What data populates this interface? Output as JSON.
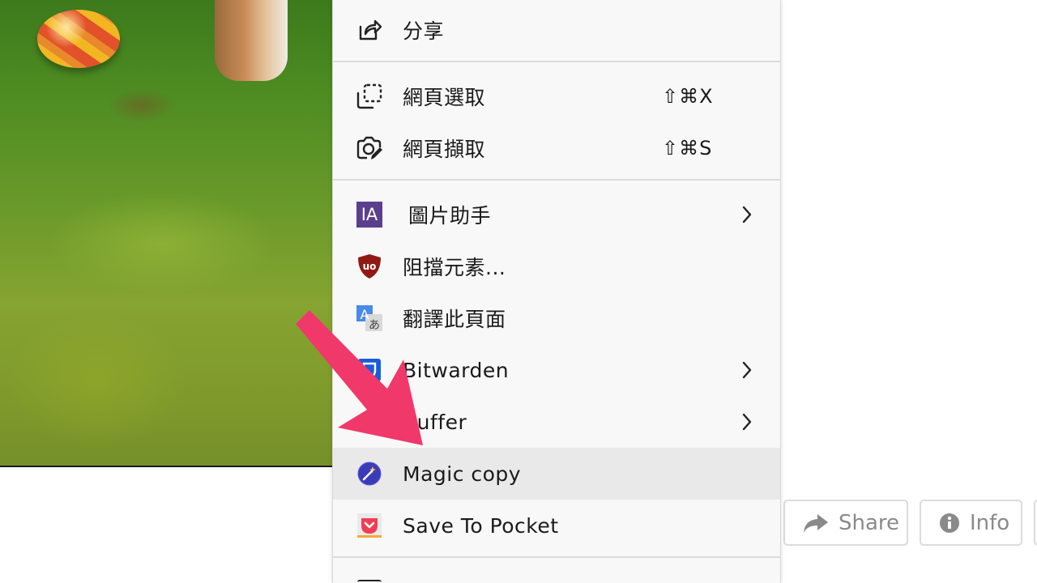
{
  "menu": {
    "items": [
      {
        "label": "分享",
        "icon": "share-icon"
      },
      {
        "label": "網頁選取",
        "shortcut": "⇧⌘X",
        "icon": "selection-icon"
      },
      {
        "label": "網頁擷取",
        "shortcut": "⇧⌘S",
        "icon": "screenshot-icon"
      },
      {
        "label": "圖片助手",
        "icon": "imageassistant-icon",
        "icon_text": "IA",
        "submenu": true
      },
      {
        "label": "阻擋元素...",
        "icon": "ublock-icon",
        "icon_text": "uo"
      },
      {
        "label": "翻譯此頁面",
        "icon": "translate-icon",
        "icon_text": "A"
      },
      {
        "label": "Bitwarden",
        "icon": "bitwarden-icon",
        "submenu": true
      },
      {
        "label": "Buffer",
        "icon": "buffer-icon",
        "submenu": true
      },
      {
        "label": "Magic copy",
        "icon": "magic-copy-icon",
        "highlighted": true
      },
      {
        "label": "Save To Pocket",
        "icon": "pocket-icon"
      }
    ],
    "colors": {
      "highlight": "#e9e9e9",
      "background": "#f8f8f8"
    }
  },
  "buttons": {
    "share": {
      "label": "Share"
    },
    "info": {
      "label": "Info"
    }
  },
  "overlay": {
    "arrow_color": "#f0386b"
  }
}
